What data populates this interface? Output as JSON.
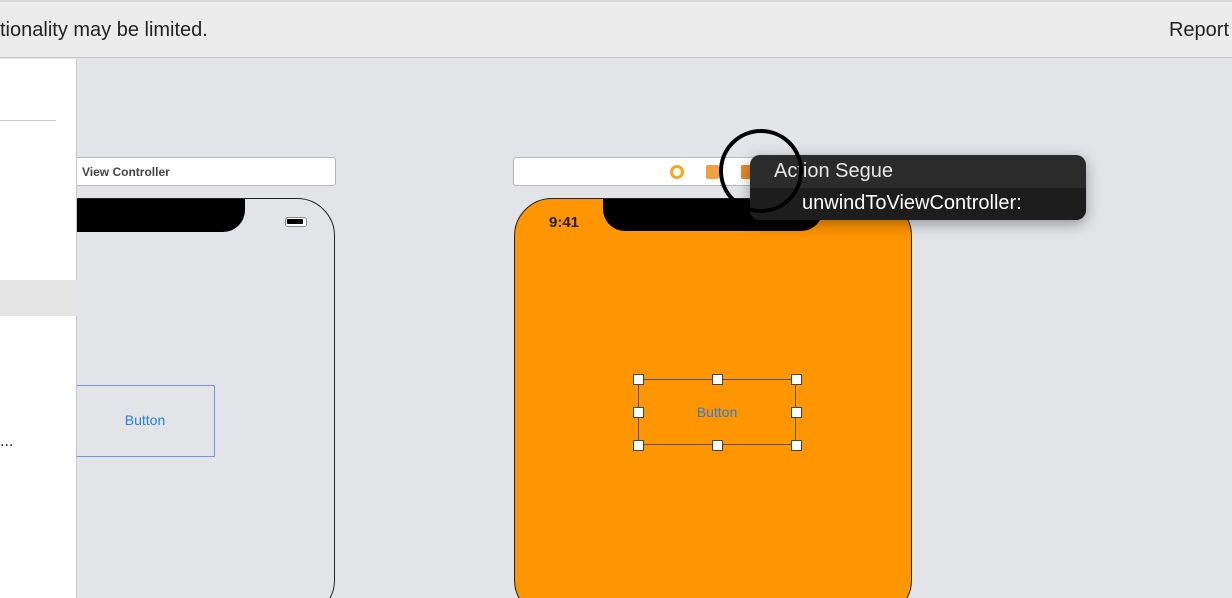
{
  "banner": {
    "message": "tionality may be limited.",
    "report_label": "Report"
  },
  "sidebar": {
    "truncated_item": "..."
  },
  "scenes": {
    "left": {
      "title": "View Controller",
      "button_label": "Button"
    },
    "right": {
      "title": "",
      "status_time": "9:41",
      "button_label": "Button",
      "background_color": "#ff9500"
    }
  },
  "tooltip": {
    "title": "Action Segue",
    "subtitle": "unwindToViewController:"
  },
  "colors": {
    "canvas": "#e3e4e8",
    "accent": "#2a7de1",
    "orange": "#ff9500"
  }
}
